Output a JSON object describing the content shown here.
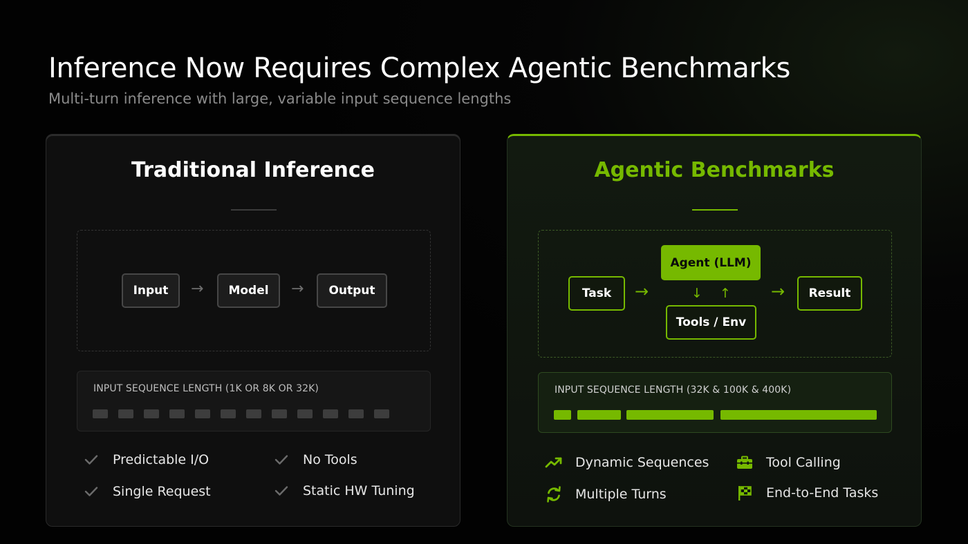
{
  "header": {
    "title": "Inference Now Requires Complex Agentic Benchmarks",
    "subtitle": "Multi-turn inference with large, variable input sequence lengths"
  },
  "left": {
    "title": "Traditional Inference",
    "flow": {
      "input": "Input",
      "model": "Model",
      "output": "Output",
      "arrow": "→"
    },
    "sequence": {
      "label": "INPUT SEQUENCE LENGTH  (1K OR 8K OR 32K)",
      "bar_count": 12
    },
    "features": [
      {
        "label": "Predictable I/O",
        "icon": "check-icon"
      },
      {
        "label": "No Tools",
        "icon": "check-icon"
      },
      {
        "label": "Single Request",
        "icon": "check-icon"
      },
      {
        "label": "Static HW Tuning",
        "icon": "check-icon"
      }
    ]
  },
  "right": {
    "title": "Agentic Benchmarks",
    "flow": {
      "task": "Task",
      "agent": "Agent (LLM)",
      "tools": "Tools / Env",
      "result": "Result",
      "arrow_right": "→",
      "arrow_down": "↓",
      "arrow_up": "↑"
    },
    "sequence": {
      "label": "INPUT SEQUENCE LENGTH (32K & 100K & 400K)",
      "segments": [
        "short",
        "medium",
        "long",
        "longest"
      ]
    },
    "features": [
      {
        "label": "Dynamic Sequences",
        "icon": "trending-up-icon"
      },
      {
        "label": "Tool Calling",
        "icon": "toolbox-icon"
      },
      {
        "label": "Multiple Turns",
        "icon": "refresh-icon"
      },
      {
        "label": "End-to-End Tasks",
        "icon": "checkered-flag-icon"
      }
    ]
  },
  "colors": {
    "accent": "#76b900",
    "background": "#050505",
    "card_left": "#0f0f0f",
    "card_right": "#121a10"
  }
}
